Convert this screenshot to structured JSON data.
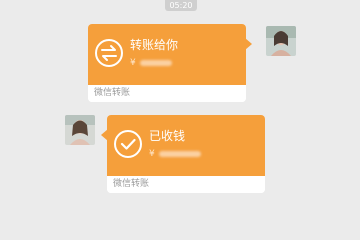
{
  "status_bar": {
    "time": "05:20"
  },
  "colors": {
    "background": "#ebebeb",
    "transfer_orange": "#f59f3b",
    "card_white": "#ffffff",
    "footer_text": "#9a9a9a"
  },
  "messages": [
    {
      "direction": "sent",
      "icon": "transfer-arrows-icon",
      "title": "转账给你",
      "currency": "¥",
      "amount_blurred": true,
      "footer": "微信转账"
    },
    {
      "direction": "received",
      "icon": "check-circle-icon",
      "title": "已收钱",
      "currency": "¥",
      "amount_blurred": true,
      "footer": "微信转账"
    }
  ]
}
